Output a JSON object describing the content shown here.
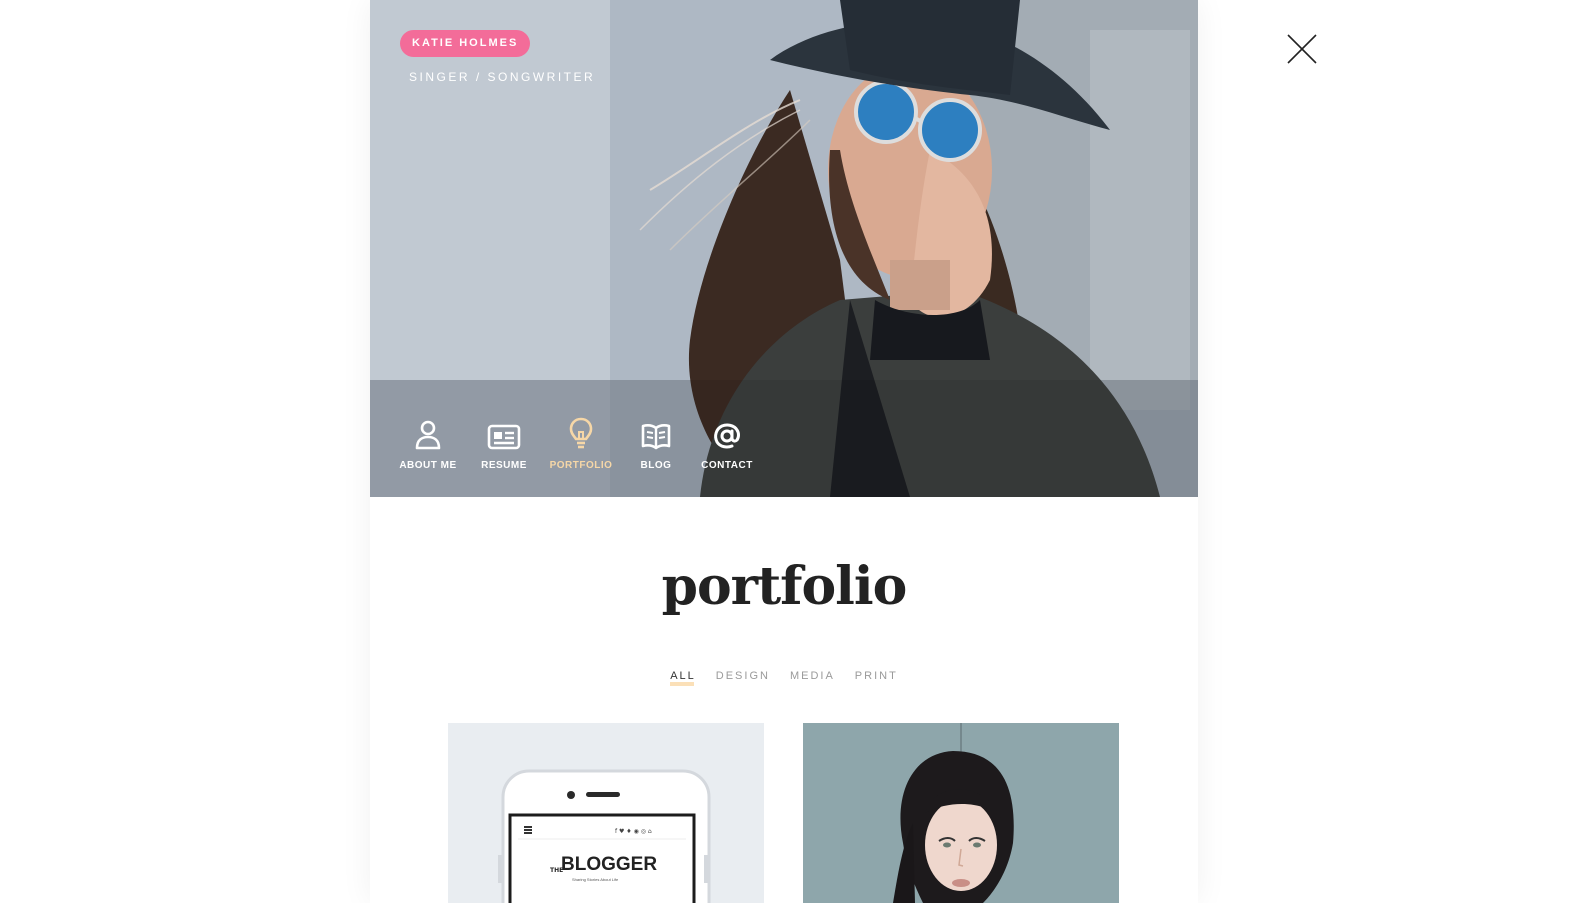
{
  "profile": {
    "name": "KATIE HOLMES",
    "role": "SINGER / SONGWRITER"
  },
  "nav": {
    "items": [
      {
        "label": "ABOUT ME",
        "icon": "user-icon"
      },
      {
        "label": "RESUME",
        "icon": "id-card-icon"
      },
      {
        "label": "PORTFOLIO",
        "icon": "lightbulb-icon",
        "active": true
      },
      {
        "label": "BLOG",
        "icon": "book-icon"
      },
      {
        "label": "CONTACT",
        "icon": "at-icon"
      }
    ]
  },
  "portfolio": {
    "title": "portfolio",
    "filters": [
      "ALL",
      "DESIGN",
      "MEDIA",
      "PRINT"
    ],
    "active_filter": "ALL",
    "tile1": {
      "logo_prefix": "THE",
      "logo": "BLOGGER",
      "tagline": "Sharing Stories About Life"
    }
  },
  "colors": {
    "accent_pink": "#f36c99",
    "active_nav": "#f6d7a7",
    "filter_underline": "#fbe0b8"
  }
}
